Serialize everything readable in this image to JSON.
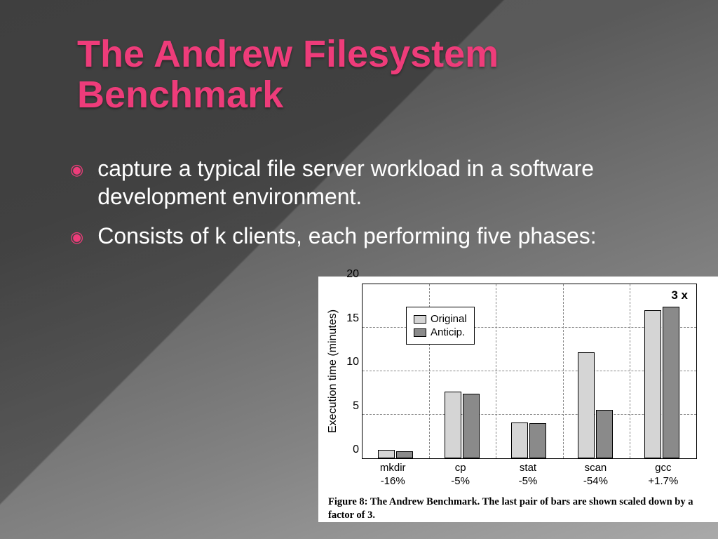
{
  "title": "The Andrew Filesystem Benchmark",
  "bullets": [
    "capture a typical file server workload in a software development environment.",
    "Consists of k clients, each performing five phases:"
  ],
  "chart_data": {
    "type": "bar",
    "title": "",
    "ylabel": "Execution time (minutes)",
    "xlabel": "",
    "ylim": [
      0,
      20
    ],
    "yticks": [
      0,
      5,
      10,
      15,
      20
    ],
    "categories": [
      "mkdir",
      "cp",
      "stat",
      "scan",
      "gcc"
    ],
    "category_sublabels": [
      "-16%",
      "-5%",
      "-5%",
      "-54%",
      "+1.7%"
    ],
    "series": [
      {
        "name": "Original",
        "values": [
          1.0,
          7.7,
          4.1,
          12.2,
          17.0
        ]
      },
      {
        "name": "Anticip.",
        "values": [
          0.8,
          7.4,
          4.0,
          5.6,
          17.4
        ]
      }
    ],
    "annotations": [
      {
        "text": "3 x",
        "category_index": 4,
        "y": 18.2
      }
    ],
    "caption": "Figure 8: The Andrew Benchmark. The last pair of bars are shown scaled down by a factor of 3."
  },
  "colors": {
    "accent": "#ee3c7a",
    "series_original": "#d5d5d5",
    "series_anticip": "#8a8a8a"
  }
}
